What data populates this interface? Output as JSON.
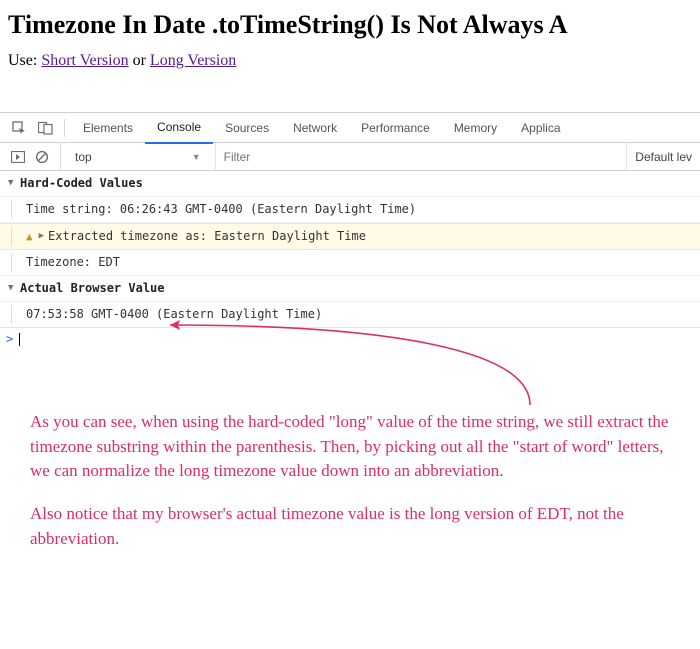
{
  "heading": "Timezone In Date .toTimeString() Is Not Always A",
  "use": {
    "label": "Use: ",
    "link1": "Short Version",
    "or": " or ",
    "link2": "Long Version"
  },
  "devtools": {
    "tabs": {
      "elements": "Elements",
      "console": "Console",
      "sources": "Sources",
      "network": "Network",
      "performance": "Performance",
      "memory": "Memory",
      "application": "Applica"
    },
    "context": "top",
    "filter_placeholder": "Filter",
    "levels": "Default lev"
  },
  "console": {
    "group1": "Hard-Coded Values",
    "line1": "Time string: 06:26:43 GMT-0400 (Eastern Daylight Time)",
    "line2": "Extracted timezone as: Eastern Daylight Time",
    "line3": "Timezone: EDT",
    "group2": "Actual Browser Value",
    "line4": "07:53:58 GMT-0400 (Eastern Daylight Time)"
  },
  "annotation": {
    "p1": "As you can see, when using the hard-coded \"long\" value of the time string, we still extract the timezone substring within the parenthesis. Then, by picking out all the \"start of word\" letters, we can normalize the long timezone value down into an abbreviation.",
    "p2": "Also notice that my browser's actual timezone value is the long version of EDT, not the abbreviation."
  }
}
